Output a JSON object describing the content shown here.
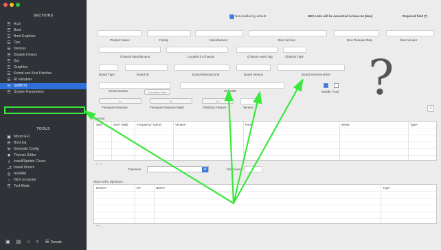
{
  "sidebar": {
    "sections_title": "SECTIONS",
    "sections": [
      {
        "label": "Acpi",
        "icon": "list-icon"
      },
      {
        "label": "Boot",
        "icon": "list-icon"
      },
      {
        "label": "Boot Graphics",
        "icon": "list-icon"
      },
      {
        "label": "Cpu",
        "icon": "list-icon"
      },
      {
        "label": "Devices",
        "icon": "list-icon"
      },
      {
        "label": "Disable Drivers",
        "icon": "list-icon"
      },
      {
        "label": "Gui",
        "icon": "list-icon"
      },
      {
        "label": "Graphics",
        "icon": "list-icon"
      },
      {
        "label": "Kernel and Kext Patches",
        "icon": "list-icon"
      },
      {
        "label": "Rt Variables",
        "icon": "list-icon"
      },
      {
        "label": "SMBIOS",
        "icon": "list-icon"
      },
      {
        "label": "System Parameters",
        "icon": "list-icon"
      }
    ],
    "selected": "SMBIOS",
    "tools_title": "TOOLS",
    "tools": [
      {
        "label": "Mount EFI",
        "icon": "disk-icon"
      },
      {
        "label": "Boot.log",
        "icon": "log-icon"
      },
      {
        "label": "Generate Config",
        "icon": "wrench-icon"
      },
      {
        "label": "Themes Editor",
        "icon": "palette-icon"
      },
      {
        "label": "Install/Update Clover",
        "icon": "download-icon"
      },
      {
        "label": "Install Drivers",
        "icon": "drivers-icon"
      },
      {
        "label": "NVRAM",
        "icon": "chip-icon"
      },
      {
        "label": "HEX converter",
        "icon": "hex-icon"
      },
      {
        "label": "Text Mode",
        "icon": "text-icon"
      }
    ],
    "donate_label": "Donate"
  },
  "topbar": {
    "not_enabled_label": "Not enabled by default",
    "hex_note": "HEX code will be converted in base 64 [Hex]",
    "required_label": "Required field (*)"
  },
  "smbios": {
    "row1_labels": [
      "Product Name",
      "Family",
      "Manufacturer",
      "Bios Version",
      "Bios Release Date",
      "Bios Vendor"
    ],
    "row2_labels": [
      "Chassis Manufacturer",
      "Location in Chassis",
      "Chassis Asset Tag",
      "Chassis Type"
    ],
    "row3_labels": [
      "Board Type",
      "Board ID",
      "Board Manufacturer",
      "Board Version",
      "Board Serial Number"
    ],
    "serial_label": "Serial Number",
    "generate_new_label": "Generate New",
    "smuuid_label": "SmUUID",
    "mobile_label": "Mobile",
    "trust_label": "Trust",
    "btn_placeholder": "0x",
    "row4_labels": [
      "Firmware Features",
      "Firmware Features Mask",
      "Platform Feature",
      "Version"
    ]
  },
  "memory": {
    "title": "Memory",
    "columns": [
      "Slot*",
      "Size* (MB)",
      "Frequency* (MHz)",
      "Vendor*",
      "Part",
      "Serial",
      "Type*"
    ],
    "channels_label": "Channels",
    "slot_count_label": "SlotCount"
  },
  "slots": {
    "title": "Slots AAPL Injections",
    "columns": [
      "Device*",
      "ID*",
      "Name*",
      "Type*"
    ]
  },
  "colors": {
    "sidebar_bg": "#2f3237",
    "accent": "#2e6fd8",
    "highlight": "#39e83a"
  }
}
